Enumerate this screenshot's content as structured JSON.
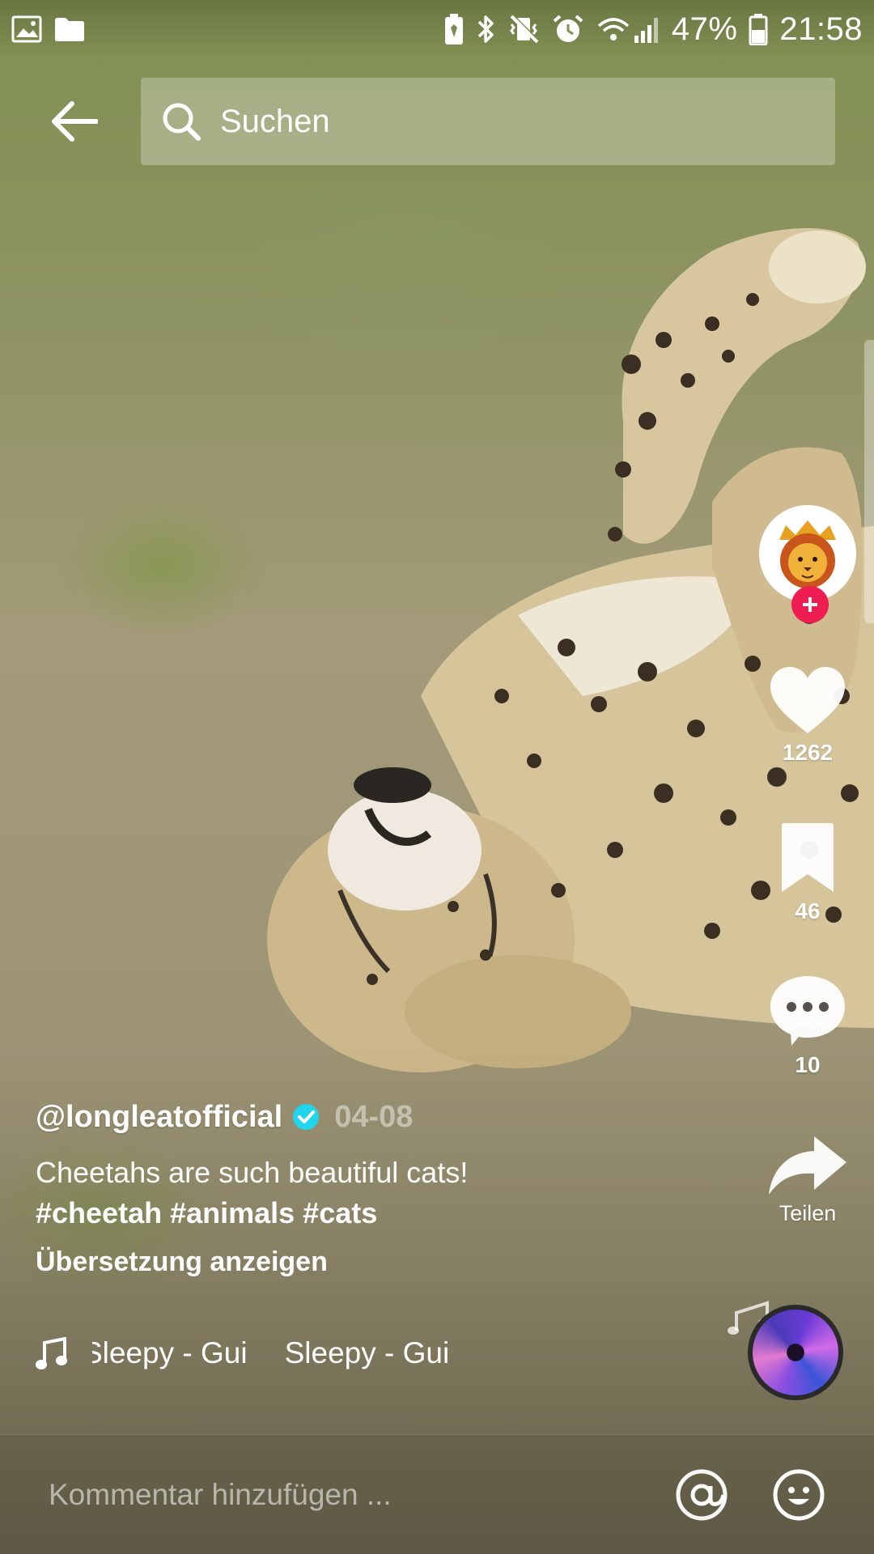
{
  "status_bar": {
    "battery": "47%",
    "time": "21:58"
  },
  "search": {
    "placeholder": "Suchen"
  },
  "actions": {
    "likes": "1262",
    "saves": "46",
    "comments": "10",
    "share_label": "Teilen"
  },
  "post": {
    "author": "@longleatofficial",
    "date": "04-08",
    "caption": "Cheetahs are such beautiful cats!",
    "hashtags": "#cheetah #animals #cats",
    "translate": "Übersetzung anzeigen"
  },
  "music": {
    "track_a": "Sleepy - Gui",
    "track_b": "Sleepy - Gui"
  },
  "comment_bar": {
    "placeholder": "Kommentar hinzufügen ..."
  },
  "colors": {
    "follow_red": "#ee1d52",
    "verified_blue": "#20d5ec"
  }
}
